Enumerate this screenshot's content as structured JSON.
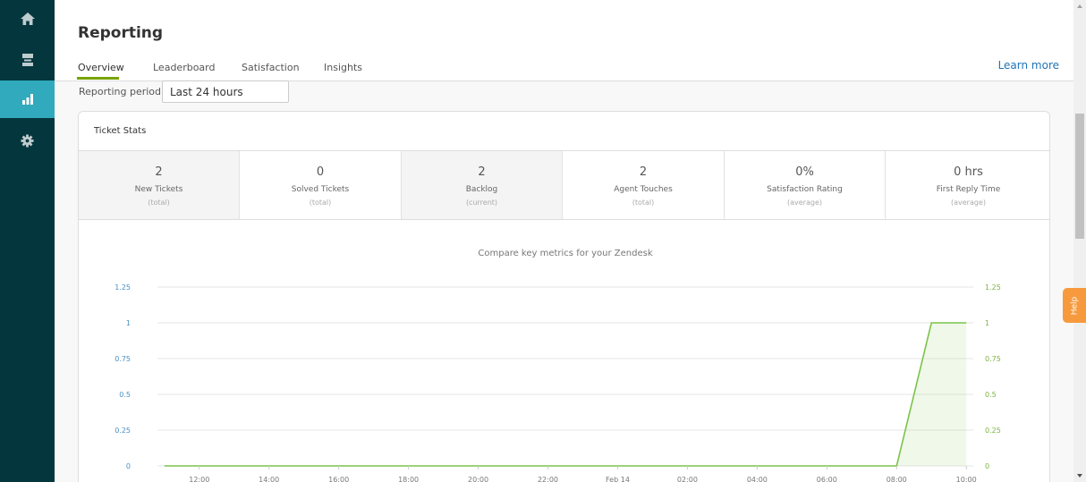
{
  "page": {
    "title": "Reporting",
    "learn_more": "Learn more",
    "reporting_period_label": "Reporting period:",
    "reporting_period_value": "Last 24 hours",
    "help": "Help"
  },
  "tabs": [
    {
      "label": "Overview",
      "active": true
    },
    {
      "label": "Leaderboard",
      "active": false
    },
    {
      "label": "Satisfaction",
      "active": false
    },
    {
      "label": "Insights",
      "active": false
    }
  ],
  "sidebar": {
    "items": [
      {
        "icon": "home-icon",
        "active": false
      },
      {
        "icon": "views-icon",
        "active": false
      },
      {
        "icon": "reporting-icon",
        "active": true
      },
      {
        "icon": "gear-icon",
        "active": false
      }
    ]
  },
  "panel": {
    "title": "Ticket Stats",
    "stats": [
      {
        "value": "2",
        "label": "New Tickets",
        "sub": "(total)"
      },
      {
        "value": "0",
        "label": "Solved Tickets",
        "sub": "(total)"
      },
      {
        "value": "2",
        "label": "Backlog",
        "sub": "(current)"
      },
      {
        "value": "2",
        "label": "Agent Touches",
        "sub": "(total)"
      },
      {
        "value": "0%",
        "label": "Satisfaction Rating",
        "sub": "(average)"
      },
      {
        "value": "0 hrs",
        "label": "First Reply Time",
        "sub": "(average)"
      }
    ]
  },
  "colors": {
    "sidebar": "#03363d",
    "sidebar_active": "#30aabc",
    "tab_underline": "#78a300",
    "link": "#1f73b7",
    "left_axis": "#4a90c2",
    "right_axis": "#7cb342",
    "line": "#7cc34a",
    "help": "#f79a3e"
  },
  "chart_data": {
    "type": "line",
    "title": "Compare key metrics for your Zendesk",
    "x_ticks": [
      "12:00",
      "14:00",
      "16:00",
      "18:00",
      "20:00",
      "22:00",
      "Feb 14",
      "02:00",
      "04:00",
      "06:00",
      "08:00",
      "10:00"
    ],
    "y_ticks_left": [
      "1.25",
      "1",
      "0.75",
      "0.5",
      "0.25",
      "0"
    ],
    "y_ticks_right": [
      "1.25",
      "1",
      "0.75",
      "0.5",
      "0.25",
      "0"
    ],
    "ylim": [
      0,
      1.25
    ],
    "xlim_hours": [
      10.8,
      34.2
    ],
    "grid": true,
    "series": [
      {
        "x_hours": [
          11,
          12,
          14,
          16,
          18,
          20,
          22,
          24,
          26,
          28,
          30,
          32,
          33,
          34
        ],
        "values": [
          0,
          0,
          0,
          0,
          0,
          0,
          0,
          0,
          0,
          0,
          0,
          0,
          1,
          1
        ]
      }
    ]
  }
}
